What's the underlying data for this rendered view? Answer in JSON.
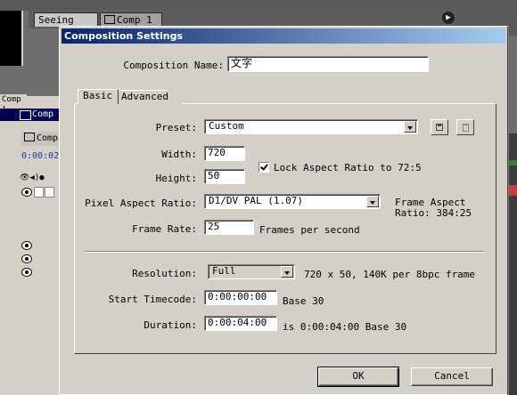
{
  "background": {
    "tabs": [
      "Seeing",
      "Comp 1"
    ],
    "left_tab": "Comp 1",
    "left_panel_title": "Comp",
    "left_sub_label": "Comp",
    "timecode": "0:00:02"
  },
  "dialog": {
    "title": "Composition Settings",
    "composition_name_label": "Composition Name:",
    "composition_name_value": "文字",
    "tabs": {
      "basic": "Basic",
      "advanced": "Advanced"
    },
    "preset": {
      "label": "Preset:",
      "value": "Custom"
    },
    "width": {
      "label": "Width:",
      "value": "720"
    },
    "height": {
      "label": "Height:",
      "value": "50"
    },
    "lock_aspect": {
      "label": "Lock Aspect Ratio to 72:5",
      "checked": true
    },
    "pixel_aspect": {
      "label": "Pixel Aspect Ratio:",
      "value": "D1/DV PAL (1.07)"
    },
    "frame_aspect": {
      "line1": "Frame Aspect",
      "line2": "Ratio: 384:25"
    },
    "frame_rate": {
      "label": "Frame Rate:",
      "value": "25",
      "unit": "Frames per second"
    },
    "resolution": {
      "label": "Resolution:",
      "value": "Full",
      "info": "720 x 50, 140K per 8bpc frame"
    },
    "start_timecode": {
      "label": "Start Timecode:",
      "value": "0:00:00:00",
      "base": "Base 30"
    },
    "duration": {
      "label": "Duration:",
      "value": "0:00:04:00",
      "info": "is 0:00:04:00  Base 30"
    },
    "buttons": {
      "ok": "OK",
      "cancel": "Cancel"
    }
  }
}
